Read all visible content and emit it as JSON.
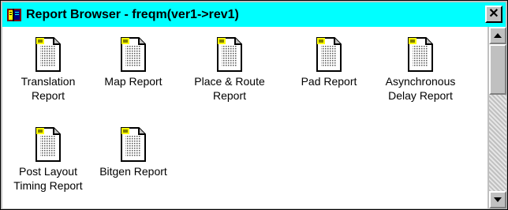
{
  "window": {
    "title": "Report Browser - freqm(ver1->rev1)",
    "close_label": "✕"
  },
  "reports": [
    {
      "label": "Translation Report",
      "icon": "report-document-icon"
    },
    {
      "label": "Map Report",
      "icon": "report-document-icon"
    },
    {
      "label": "Place & Route Report",
      "icon": "report-document-icon"
    },
    {
      "label": "Pad Report",
      "icon": "report-document-icon"
    },
    {
      "label": "Asynchronous Delay Report",
      "icon": "report-document-icon"
    },
    {
      "label": "Post Layout Timing Report",
      "icon": "report-document-icon"
    },
    {
      "label": "Bitgen Report",
      "icon": "report-document-icon"
    }
  ],
  "colors": {
    "titlebar": "#00ffff",
    "client_background": "#ffffff",
    "chrome": "#c0c0c0"
  }
}
